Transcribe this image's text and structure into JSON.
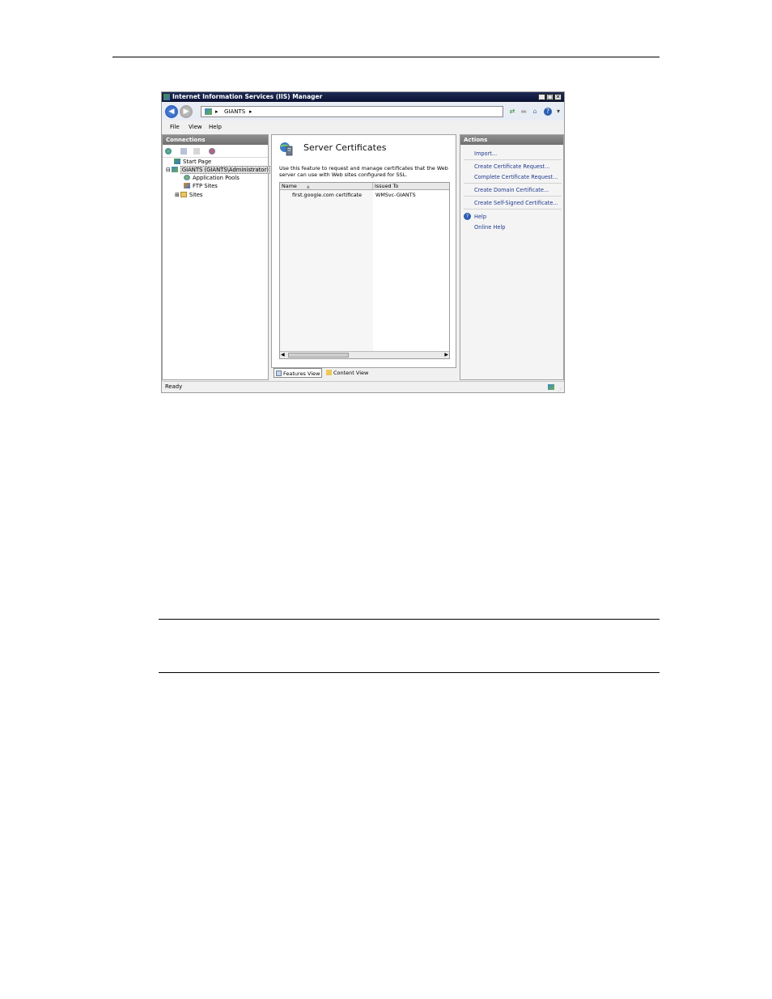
{
  "window": {
    "title": "Internet Information Services (IIS) Manager",
    "minimize": "_",
    "maximize": "□",
    "close": "✕"
  },
  "address": {
    "node": "GIANTS"
  },
  "menu": [
    "File",
    "View",
    "Help"
  ],
  "connections": {
    "header": "Connections",
    "tree": [
      {
        "label": "Start Page",
        "icon": "start-page-icon"
      },
      {
        "label": "GIANTS (GIANTS\\Administrator)",
        "icon": "server-icon",
        "expander": "⊟",
        "selected": true
      },
      {
        "label": "Application Pools",
        "icon": "app-pools-icon"
      },
      {
        "label": "FTP Sites",
        "icon": "ftp-sites-icon"
      },
      {
        "label": "Sites",
        "icon": "sites-folder-icon",
        "expander": "⊞"
      }
    ]
  },
  "feature": {
    "title": "Server Certificates",
    "description": "Use this feature to request and manage certificates that the Web server can use with Web sites configured for SSL.",
    "columns": [
      "Name",
      "Issued To"
    ],
    "sort_indicator": "▲",
    "rows": [
      {
        "name": "first.google.com certificate",
        "issued_to": "WMSvc-GIANTS"
      }
    ]
  },
  "views": {
    "features": "Features View",
    "content": "Content View"
  },
  "actions": {
    "header": "Actions",
    "items": [
      "Import...",
      "Create Certificate Request...",
      "Complete Certificate Request...",
      "Create Domain Certificate...",
      "Create Self-Signed Certificate...",
      "Help",
      "Online Help"
    ]
  },
  "status": {
    "text": "Ready"
  },
  "colors": {
    "titlebar": "#0b1233",
    "link": "#1f3a8f",
    "panel_header": "#7a7a7a"
  }
}
